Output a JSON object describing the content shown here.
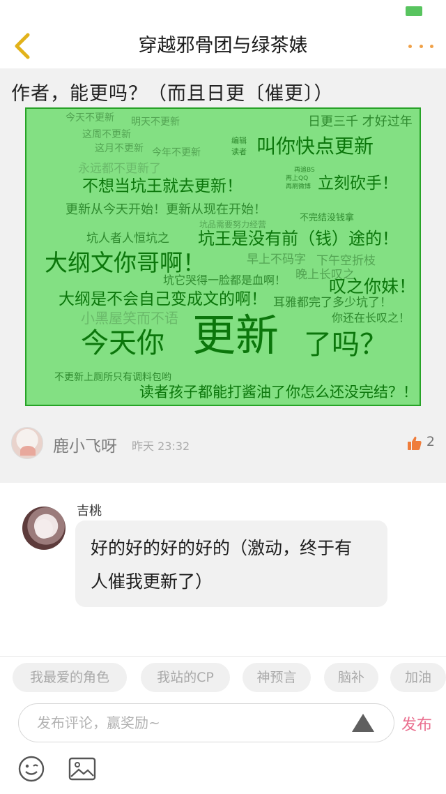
{
  "header": {
    "title": "穿越邪骨团与绿茶婊"
  },
  "post": {
    "text": "作者，能更吗？（而且日更〔催更〕）",
    "author": "鹿小飞呀",
    "time": "昨天 23:32",
    "likes": "2",
    "meme": [
      "今天不更新",
      "明天不更新",
      "这周不更新",
      "这月不更新",
      "今年不更新",
      "日更三千 才好过年",
      "编辑",
      "读者",
      "叫你快点更新",
      "永远都不更新了",
      "再追BS",
      "再上QQ",
      "再刷微博",
      "立刻砍手！",
      "不想当坑王就去更新！",
      "更新从今天开始！更新从现在开始！",
      "不完结没钱拿",
      "坑品需要努力经营",
      "坑人者人恒坑之",
      "坑王是没有前（钱）途的！",
      "大纲文你哥啊！",
      "早上不码字",
      "下午空折枝",
      "坑它哭得一脸都是血啊！",
      "晚上长叹之",
      "叹之你妹！",
      "大纲是不会自己变成文的啊！",
      "耳雅都完了多少坑了！",
      "小黑屋笑而不语",
      "你还在长叹之！",
      "今天你",
      "更新",
      "了吗？",
      "不更新上厕所只有调料包哟",
      "读者孩子都能打酱油了你怎么还没完结？！"
    ]
  },
  "comment": {
    "name": "吉桃",
    "text_line1": "好的好的好的好的（激动，终于有",
    "text_line2": "人催我更新了）"
  },
  "tags": [
    "我最爱的角色",
    "我站的CP",
    "神预言",
    "脑补",
    "加油"
  ],
  "input": {
    "placeholder": "发布评论，赢奖励~",
    "publish_label": "发布"
  },
  "colors": {
    "accent_orange": "#f0a148",
    "publish_pink": "#ea6f8f",
    "battery_green": "#58c45f",
    "meme_bg": "#83e083"
  }
}
